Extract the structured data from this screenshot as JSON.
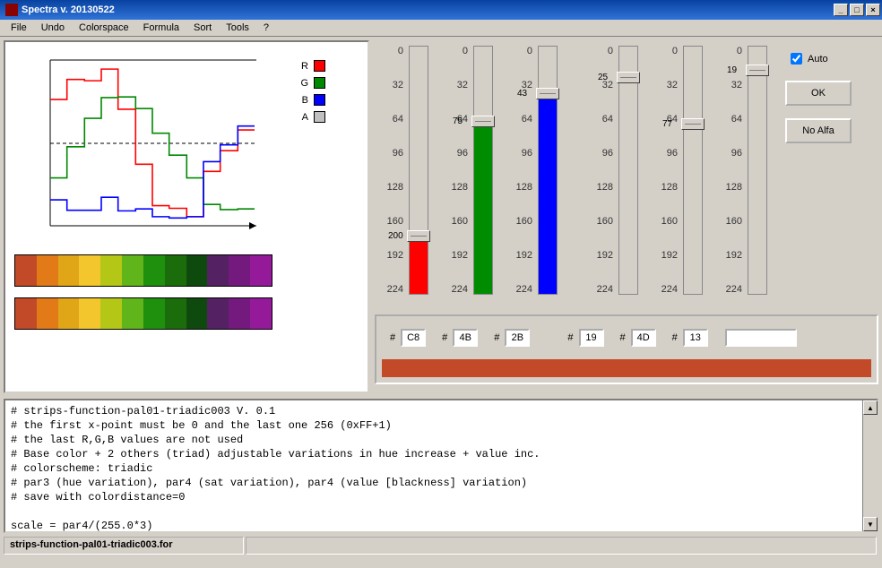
{
  "window": {
    "title": "Spectra v. 20130522"
  },
  "menu": [
    "File",
    "Undo",
    "Colorspace",
    "Formula",
    "Sort",
    "Tools",
    "?"
  ],
  "legend": [
    {
      "label": "R",
      "color": "#ff0000"
    },
    {
      "label": "G",
      "color": "#008800"
    },
    {
      "label": "B",
      "color": "#0000ff"
    },
    {
      "label": "A",
      "color": "#c0c0c0"
    }
  ],
  "palette1": [
    "#c34a28",
    "#e27a18",
    "#e0a618",
    "#f2c62c",
    "#b4c717",
    "#5fb51a",
    "#1f8f0e",
    "#1b6d0c",
    "#0e4a0e",
    "#542163",
    "#74197d",
    "#941a9a"
  ],
  "palette2": [
    "#c34a28",
    "#e27a18",
    "#e0a618",
    "#f2c62c",
    "#b4c717",
    "#5fb51a",
    "#1f8f0e",
    "#1b6d0c",
    "#0e4a0e",
    "#542163",
    "#74197d",
    "#941a9a"
  ],
  "slider_ticks": [
    "0",
    "32",
    "64",
    "96",
    "128",
    "160",
    "192",
    "224"
  ],
  "sliders": [
    {
      "value": 200,
      "fill_color": "#ff0000",
      "fill_pct": 22
    },
    {
      "value": 75,
      "fill_color": "#008c00",
      "fill_pct": 71
    },
    {
      "value": 43,
      "fill_color": "#0000ff",
      "fill_pct": 83
    },
    {
      "value": 25,
      "fill_color": "",
      "fill_pct": 90
    },
    {
      "value": 77,
      "fill_color": "",
      "fill_pct": 70
    },
    {
      "value": 19,
      "fill_color": "",
      "fill_pct": 93
    }
  ],
  "hex": [
    "C8",
    "4B",
    "2B",
    "19",
    "4D",
    "13"
  ],
  "auto_label": "Auto",
  "auto_checked": true,
  "ok_label": "OK",
  "noalfa_label": "No Alfa",
  "preview_color": "#c34a28",
  "script_text": "# strips-function-pal01-triadic003 V. 0.1\n# the first x-point must be 0 and the last one 256 (0xFF+1)\n# the last R,G,B values are not used\n# Base color + 2 others (triad) adjustable variations in hue increase + value inc.\n# colorscheme: triadic\n# par3 (hue variation), par4 (sat variation), par4 (value [blackness] variation)\n# save with colordistance=0\n\nscale = par4/(255.0*3)",
  "status": "strips-function-pal01-triadic003.for",
  "chart_data": {
    "type": "line",
    "xlim": [
      0,
      256
    ],
    "ylim": [
      0,
      256
    ],
    "x": [
      0,
      21,
      43,
      64,
      85,
      107,
      128,
      149,
      171,
      192,
      213,
      235,
      256
    ],
    "series": [
      {
        "name": "R",
        "color": "#ff0000",
        "values": [
          195,
          226,
          224,
          242,
          180,
          95,
          31,
          27,
          14,
          84,
          116,
          148,
          148
        ]
      },
      {
        "name": "G",
        "color": "#008800",
        "values": [
          74,
          122,
          166,
          198,
          199,
          181,
          143,
          109,
          74,
          33,
          25,
          26,
          26
        ]
      },
      {
        "name": "B",
        "color": "#0000ff",
        "values": [
          40,
          24,
          24,
          44,
          23,
          26,
          14,
          12,
          14,
          99,
          125,
          154,
          154
        ]
      }
    ],
    "guides": {
      "hline_dashed_at": 128
    }
  }
}
